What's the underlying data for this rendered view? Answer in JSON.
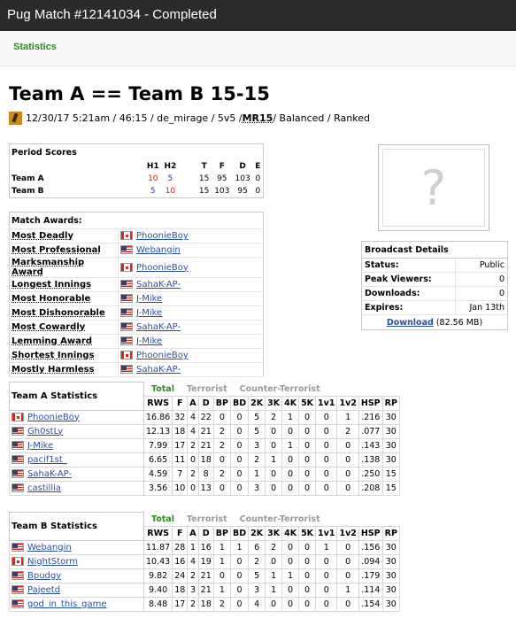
{
  "window": {
    "title": "Pug Match #12141034 - Completed"
  },
  "nav": {
    "statistics": "Statistics"
  },
  "match": {
    "heading": "Team A == Team B 15-15",
    "meta_pre": "12/30/17 5:21am / 46:15 / de_mirage / 5v5 / ",
    "mr": "MR15",
    "meta_post": " / Balanced / Ranked"
  },
  "period_scores": {
    "title": "Period Scores",
    "headers": [
      "H1",
      "H2",
      "T",
      "F",
      "D",
      "E"
    ],
    "rows": [
      {
        "team": "Team A",
        "h1": "10",
        "h2": "5",
        "t": "15",
        "f": "95",
        "d": "103",
        "e": "0"
      },
      {
        "team": "Team B",
        "h1": "5",
        "h2": "10",
        "t": "15",
        "f": "103",
        "d": "95",
        "e": "0"
      }
    ]
  },
  "awards": {
    "title": "Match Awards:",
    "items": [
      {
        "award": "Most Deadly",
        "player": "PhoonieBoy",
        "flag": "ca"
      },
      {
        "award": "Most Professional",
        "player": "Webangin",
        "flag": "us"
      },
      {
        "award": "Marksmanship Award",
        "player": "PhoonieBoy",
        "flag": "ca"
      },
      {
        "award": "Longest Innings",
        "player": "SahaK-AP-",
        "flag": "us"
      },
      {
        "award": "Most Honorable",
        "player": "J-Mike",
        "flag": "us"
      },
      {
        "award": "Most Dishonorable",
        "player": "J-Mike",
        "flag": "us"
      },
      {
        "award": "Most Cowardly",
        "player": "SahaK-AP-",
        "flag": "us"
      },
      {
        "award": "Lemming Award",
        "player": "J-Mike",
        "flag": "us"
      },
      {
        "award": "Shortest Innings",
        "player": "PhoonieBoy",
        "flag": "ca"
      },
      {
        "award": "Mostly Harmless",
        "player": "SahaK-AP-",
        "flag": "us"
      }
    ]
  },
  "preview": {
    "placeholder": "?"
  },
  "broadcast": {
    "title": "Broadcast Details",
    "rows": [
      {
        "label": "Status:",
        "value": "Public"
      },
      {
        "label": "Peak Viewers:",
        "value": "0"
      },
      {
        "label": "Downloads:",
        "value": "0"
      },
      {
        "label": "Expires:",
        "value": "Jan 13th"
      }
    ],
    "download_label": "Download",
    "download_size": "(82.56 MB)"
  },
  "stats_tabs": {
    "total": "Total",
    "terrorist": "Terrorist",
    "ct": "Counter-Terrorist"
  },
  "stat_columns": [
    "RWS",
    "F",
    "A",
    "D",
    "BP",
    "BD",
    "2K",
    "3K",
    "4K",
    "5K",
    "1v1",
    "1v2",
    "HSP",
    "RP"
  ],
  "team_a": {
    "title": "Team A Statistics",
    "players": [
      {
        "name": "PhoonieBoy",
        "flag": "ca",
        "stats": [
          "16.86",
          "32",
          "4",
          "22",
          "0",
          "0",
          "5",
          "2",
          "1",
          "0",
          "0",
          "1",
          ".216",
          "30"
        ]
      },
      {
        "name": "Gh0stLy",
        "flag": "us",
        "stats": [
          "12.13",
          "18",
          "4",
          "21",
          "2",
          "0",
          "5",
          "0",
          "0",
          "0",
          "0",
          "2",
          ".077",
          "30"
        ]
      },
      {
        "name": "J-Mike",
        "flag": "us",
        "stats": [
          "7.99",
          "17",
          "2",
          "21",
          "2",
          "0",
          "3",
          "0",
          "1",
          "0",
          "0",
          "0",
          ".143",
          "30"
        ]
      },
      {
        "name": "pacif1st_",
        "flag": "us",
        "stats": [
          "6.65",
          "11",
          "0",
          "18",
          "0",
          "0",
          "2",
          "1",
          "0",
          "0",
          "0",
          "0",
          ".138",
          "30"
        ]
      },
      {
        "name": "SahaK-AP-",
        "flag": "us",
        "stats": [
          "4.59",
          "7",
          "2",
          "8",
          "2",
          "0",
          "1",
          "0",
          "0",
          "0",
          "0",
          "0",
          ".250",
          "15"
        ]
      },
      {
        "name": "castillia",
        "flag": "us",
        "stats": [
          "3.56",
          "10",
          "0",
          "13",
          "0",
          "0",
          "3",
          "0",
          "0",
          "0",
          "0",
          "0",
          ".208",
          "15"
        ]
      }
    ]
  },
  "team_b": {
    "title": "Team B Statistics",
    "players": [
      {
        "name": "Webangin",
        "flag": "us",
        "stats": [
          "11.87",
          "28",
          "1",
          "16",
          "1",
          "1",
          "6",
          "2",
          "0",
          "0",
          "1",
          "0",
          ".156",
          "30"
        ]
      },
      {
        "name": "NightStorm",
        "flag": "ca",
        "stats": [
          "10.43",
          "16",
          "4",
          "19",
          "1",
          "0",
          "2",
          "0",
          "0",
          "0",
          "0",
          "0",
          ".094",
          "30"
        ]
      },
      {
        "name": "Bpudgy",
        "flag": "us",
        "stats": [
          "9.82",
          "24",
          "2",
          "21",
          "0",
          "0",
          "5",
          "1",
          "1",
          "0",
          "0",
          "0",
          ".179",
          "30"
        ]
      },
      {
        "name": "Pajeetd",
        "flag": "us",
        "stats": [
          "9.40",
          "18",
          "3",
          "21",
          "1",
          "0",
          "3",
          "1",
          "0",
          "0",
          "0",
          "1",
          ".114",
          "30"
        ]
      },
      {
        "name": "god_in_this_game",
        "flag": "us",
        "stats": [
          "8.48",
          "17",
          "2",
          "18",
          "2",
          "0",
          "4",
          "0",
          "0",
          "0",
          "0",
          "0",
          ".154",
          "30"
        ]
      }
    ]
  },
  "colors": {
    "header_bg": "#2b2b2b",
    "accent_green": "#2e8b22",
    "link_blue": "#2a4fa0",
    "red": "#dd1111",
    "blue": "#1a33cc"
  }
}
